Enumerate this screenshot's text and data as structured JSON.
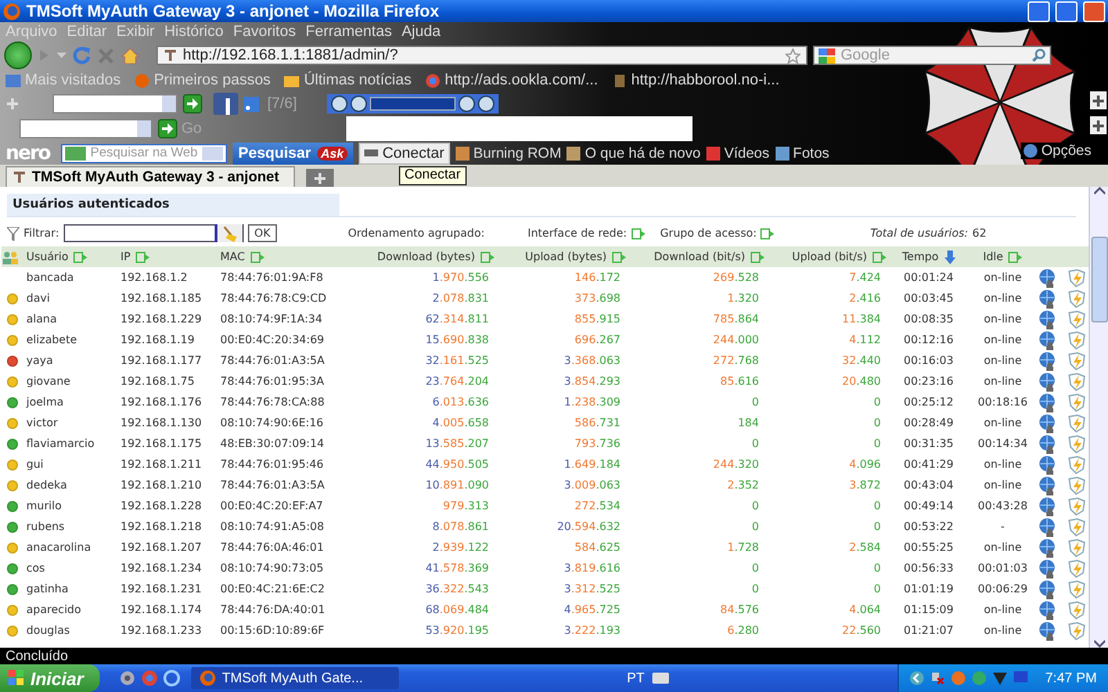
{
  "window": {
    "title": "TMSoft MyAuth Gateway 3 - anjonet - Mozilla Firefox"
  },
  "menu": [
    "Arquivo",
    "Editar",
    "Exibir",
    "Histórico",
    "Favoritos",
    "Ferramentas",
    "Ajuda"
  ],
  "navigation": {
    "url": "http://192.168.1.1:1881/admin/?",
    "search_placeholder": "Google"
  },
  "bookmarks": [
    "Mais visitados",
    "Primeiros passos",
    "Últimas notícias",
    "http://ads.ookla.com/...",
    "http://habborool.no-i..."
  ],
  "addon_toolbar": {
    "counter": "[7/6]",
    "go_label": "Go"
  },
  "nero_toolbar": {
    "logo": "nero",
    "search_placeholder": "Pesquisar na Web",
    "search_button": "Pesquisar",
    "search_badge": "Ask",
    "connect": "Conectar",
    "links": [
      "Burning ROM",
      "O que há de novo",
      "Vídeos",
      "Fotos"
    ],
    "options": "Opções"
  },
  "tabs": [
    {
      "label": "TMSoft MyAuth Gateway 3 - anjonet",
      "selected": true
    }
  ],
  "tooltip": "Conectar",
  "page": {
    "heading": "Usuários autenticados",
    "filter_label": "Filtrar:",
    "filter_button": "OK",
    "grouping_label": "Ordenamento agrupado:",
    "interface_label": "Interface de rede:",
    "group_label": "Grupo de acesso:",
    "total_label": "Total de usuários:",
    "total": "62"
  },
  "table": {
    "columns": [
      {
        "label": "Usuário",
        "sorted": false
      },
      {
        "label": "IP",
        "sorted": false
      },
      {
        "label": "MAC",
        "sorted": false
      },
      {
        "label": "Download (bytes)",
        "sorted": false
      },
      {
        "label": "Upload (bytes)",
        "sorted": false
      },
      {
        "label": "Download (bit/s)",
        "sorted": false
      },
      {
        "label": "Upload (bit/s)",
        "sorted": false
      },
      {
        "label": "Tempo",
        "sorted": true
      },
      {
        "label": "Idle",
        "sorted": false
      }
    ],
    "rows": [
      {
        "user": "bancada",
        "ip": "192.168.1.2",
        "mac": "78:44:76:01:9A:F8",
        "download_bytes": "1.970.556",
        "upload_bytes": "146.172",
        "download_bits": "269.528",
        "upload_bits": "7.424",
        "time": "00:01:24",
        "idle": "on-line"
      },
      {
        "color": "#f0c020",
        "user": "davi",
        "ip": "192.168.1.185",
        "mac": "78:44:76:78:C9:CD",
        "download_bytes": "2.078.831",
        "upload_bytes": "373.698",
        "download_bits": "1.320",
        "upload_bits": "2.416",
        "time": "00:03:45",
        "idle": "on-line"
      },
      {
        "color": "#f0c020",
        "user": "alana",
        "ip": "192.168.1.229",
        "mac": "08:10:74:9F:1A:34",
        "download_bytes": "62.314.811",
        "upload_bytes": "855.915",
        "download_bits": "785.864",
        "upload_bits": "11.384",
        "time": "00:08:35",
        "idle": "on-line"
      },
      {
        "color": "#f0c020",
        "user": "elizabete",
        "ip": "192.168.1.19",
        "mac": "00:E0:4C:20:34:69",
        "download_bytes": "15.690.838",
        "upload_bytes": "696.267",
        "download_bits": "244.000",
        "upload_bits": "4.112",
        "time": "00:12:16",
        "idle": "on-line"
      },
      {
        "color": "#e04a30",
        "user": "yaya",
        "ip": "192.168.1.177",
        "mac": "78:44:76:01:A3:5A",
        "download_bytes": "32.161.525",
        "upload_bytes": "3.368.063",
        "download_bits": "272.768",
        "upload_bits": "32.440",
        "time": "00:16:03",
        "idle": "on-line"
      },
      {
        "color": "#f0c020",
        "user": "giovane",
        "ip": "192.168.1.75",
        "mac": "78:44:76:01:95:3A",
        "download_bytes": "23.764.204",
        "upload_bytes": "3.854.293",
        "download_bits": "85.616",
        "upload_bits": "20.480",
        "time": "00:23:16",
        "idle": "on-line"
      },
      {
        "color": "#40b040",
        "user": "joelma",
        "ip": "192.168.1.176",
        "mac": "78:44:76:78:CA:88",
        "download_bytes": "6.013.636",
        "upload_bytes": "1.238.309",
        "download_bits": "0",
        "upload_bits": "0",
        "time": "00:25:12",
        "idle": "00:18:16"
      },
      {
        "color": "#f0c020",
        "user": "victor",
        "ip": "192.168.1.130",
        "mac": "08:10:74:90:6E:16",
        "download_bytes": "4.005.658",
        "upload_bytes": "586.731",
        "download_bits": "184",
        "upload_bits": "0",
        "time": "00:28:49",
        "idle": "on-line"
      },
      {
        "color": "#40b040",
        "user": "flaviamarcio",
        "ip": "192.168.1.175",
        "mac": "48:EB:30:07:09:14",
        "download_bytes": "13.585.207",
        "upload_bytes": "793.736",
        "download_bits": "0",
        "upload_bits": "0",
        "time": "00:31:35",
        "idle": "00:14:34"
      },
      {
        "color": "#f0c020",
        "user": "gui",
        "ip": "192.168.1.211",
        "mac": "78:44:76:01:95:46",
        "download_bytes": "44.950.505",
        "upload_bytes": "1.649.184",
        "download_bits": "244.320",
        "upload_bits": "4.096",
        "time": "00:41:29",
        "idle": "on-line"
      },
      {
        "color": "#f0c020",
        "user": "dedeka",
        "ip": "192.168.1.210",
        "mac": "78:44:76:01:A3:5A",
        "download_bytes": "10.891.090",
        "upload_bytes": "3.009.063",
        "download_bits": "2.352",
        "upload_bits": "3.872",
        "time": "00:43:04",
        "idle": "on-line"
      },
      {
        "color": "#40b040",
        "user": "murilo",
        "ip": "192.168.1.228",
        "mac": "00:E0:4C:20:EF:A7",
        "download_bytes": "979.313",
        "upload_bytes": "272.534",
        "download_bits": "0",
        "upload_bits": "0",
        "time": "00:49:14",
        "idle": "00:43:28"
      },
      {
        "color": "#40b040",
        "user": "rubens",
        "ip": "192.168.1.218",
        "mac": "08:10:74:91:A5:08",
        "download_bytes": "8.078.861",
        "upload_bytes": "20.594.632",
        "download_bits": "0",
        "upload_bits": "0",
        "time": "00:53:22",
        "idle": "-"
      },
      {
        "color": "#f0c020",
        "user": "anacarolina",
        "ip": "192.168.1.207",
        "mac": "78:44:76:0A:46:01",
        "download_bytes": "2.939.122",
        "upload_bytes": "584.625",
        "download_bits": "1.728",
        "upload_bits": "2.584",
        "time": "00:55:25",
        "idle": "on-line"
      },
      {
        "color": "#40b040",
        "user": "cos",
        "ip": "192.168.1.234",
        "mac": "08:10:74:90:73:05",
        "download_bytes": "41.578.369",
        "upload_bytes": "3.819.616",
        "download_bits": "0",
        "upload_bits": "0",
        "time": "00:56:33",
        "idle": "00:01:03"
      },
      {
        "color": "#40b040",
        "user": "gatinha",
        "ip": "192.168.1.231",
        "mac": "00:E0:4C:21:6E:C2",
        "download_bytes": "36.322.543",
        "upload_bytes": "3.312.525",
        "download_bits": "0",
        "upload_bits": "0",
        "time": "01:01:19",
        "idle": "00:06:29"
      },
      {
        "color": "#f0c020",
        "user": "aparecido",
        "ip": "192.168.1.174",
        "mac": "78:44:76:DA:40:01",
        "download_bytes": "68.069.484",
        "upload_bytes": "4.965.725",
        "download_bits": "84.576",
        "upload_bits": "4.064",
        "time": "01:15:09",
        "idle": "on-line"
      },
      {
        "color": "#f0c020",
        "user": "douglas",
        "ip": "192.168.1.233",
        "mac": "00:15:6D:10:89:6F",
        "download_bytes": "53.920.195",
        "upload_bytes": "3.222.193",
        "download_bits": "6.280",
        "upload_bits": "22.560",
        "time": "01:21:07",
        "idle": "on-line"
      }
    ]
  },
  "status_bar": "Concluído",
  "taskbar": {
    "start": "Iniciar",
    "tasks": [
      "TMSoft MyAuth Gate..."
    ],
    "language": "PT",
    "clock": "7:47 PM"
  }
}
